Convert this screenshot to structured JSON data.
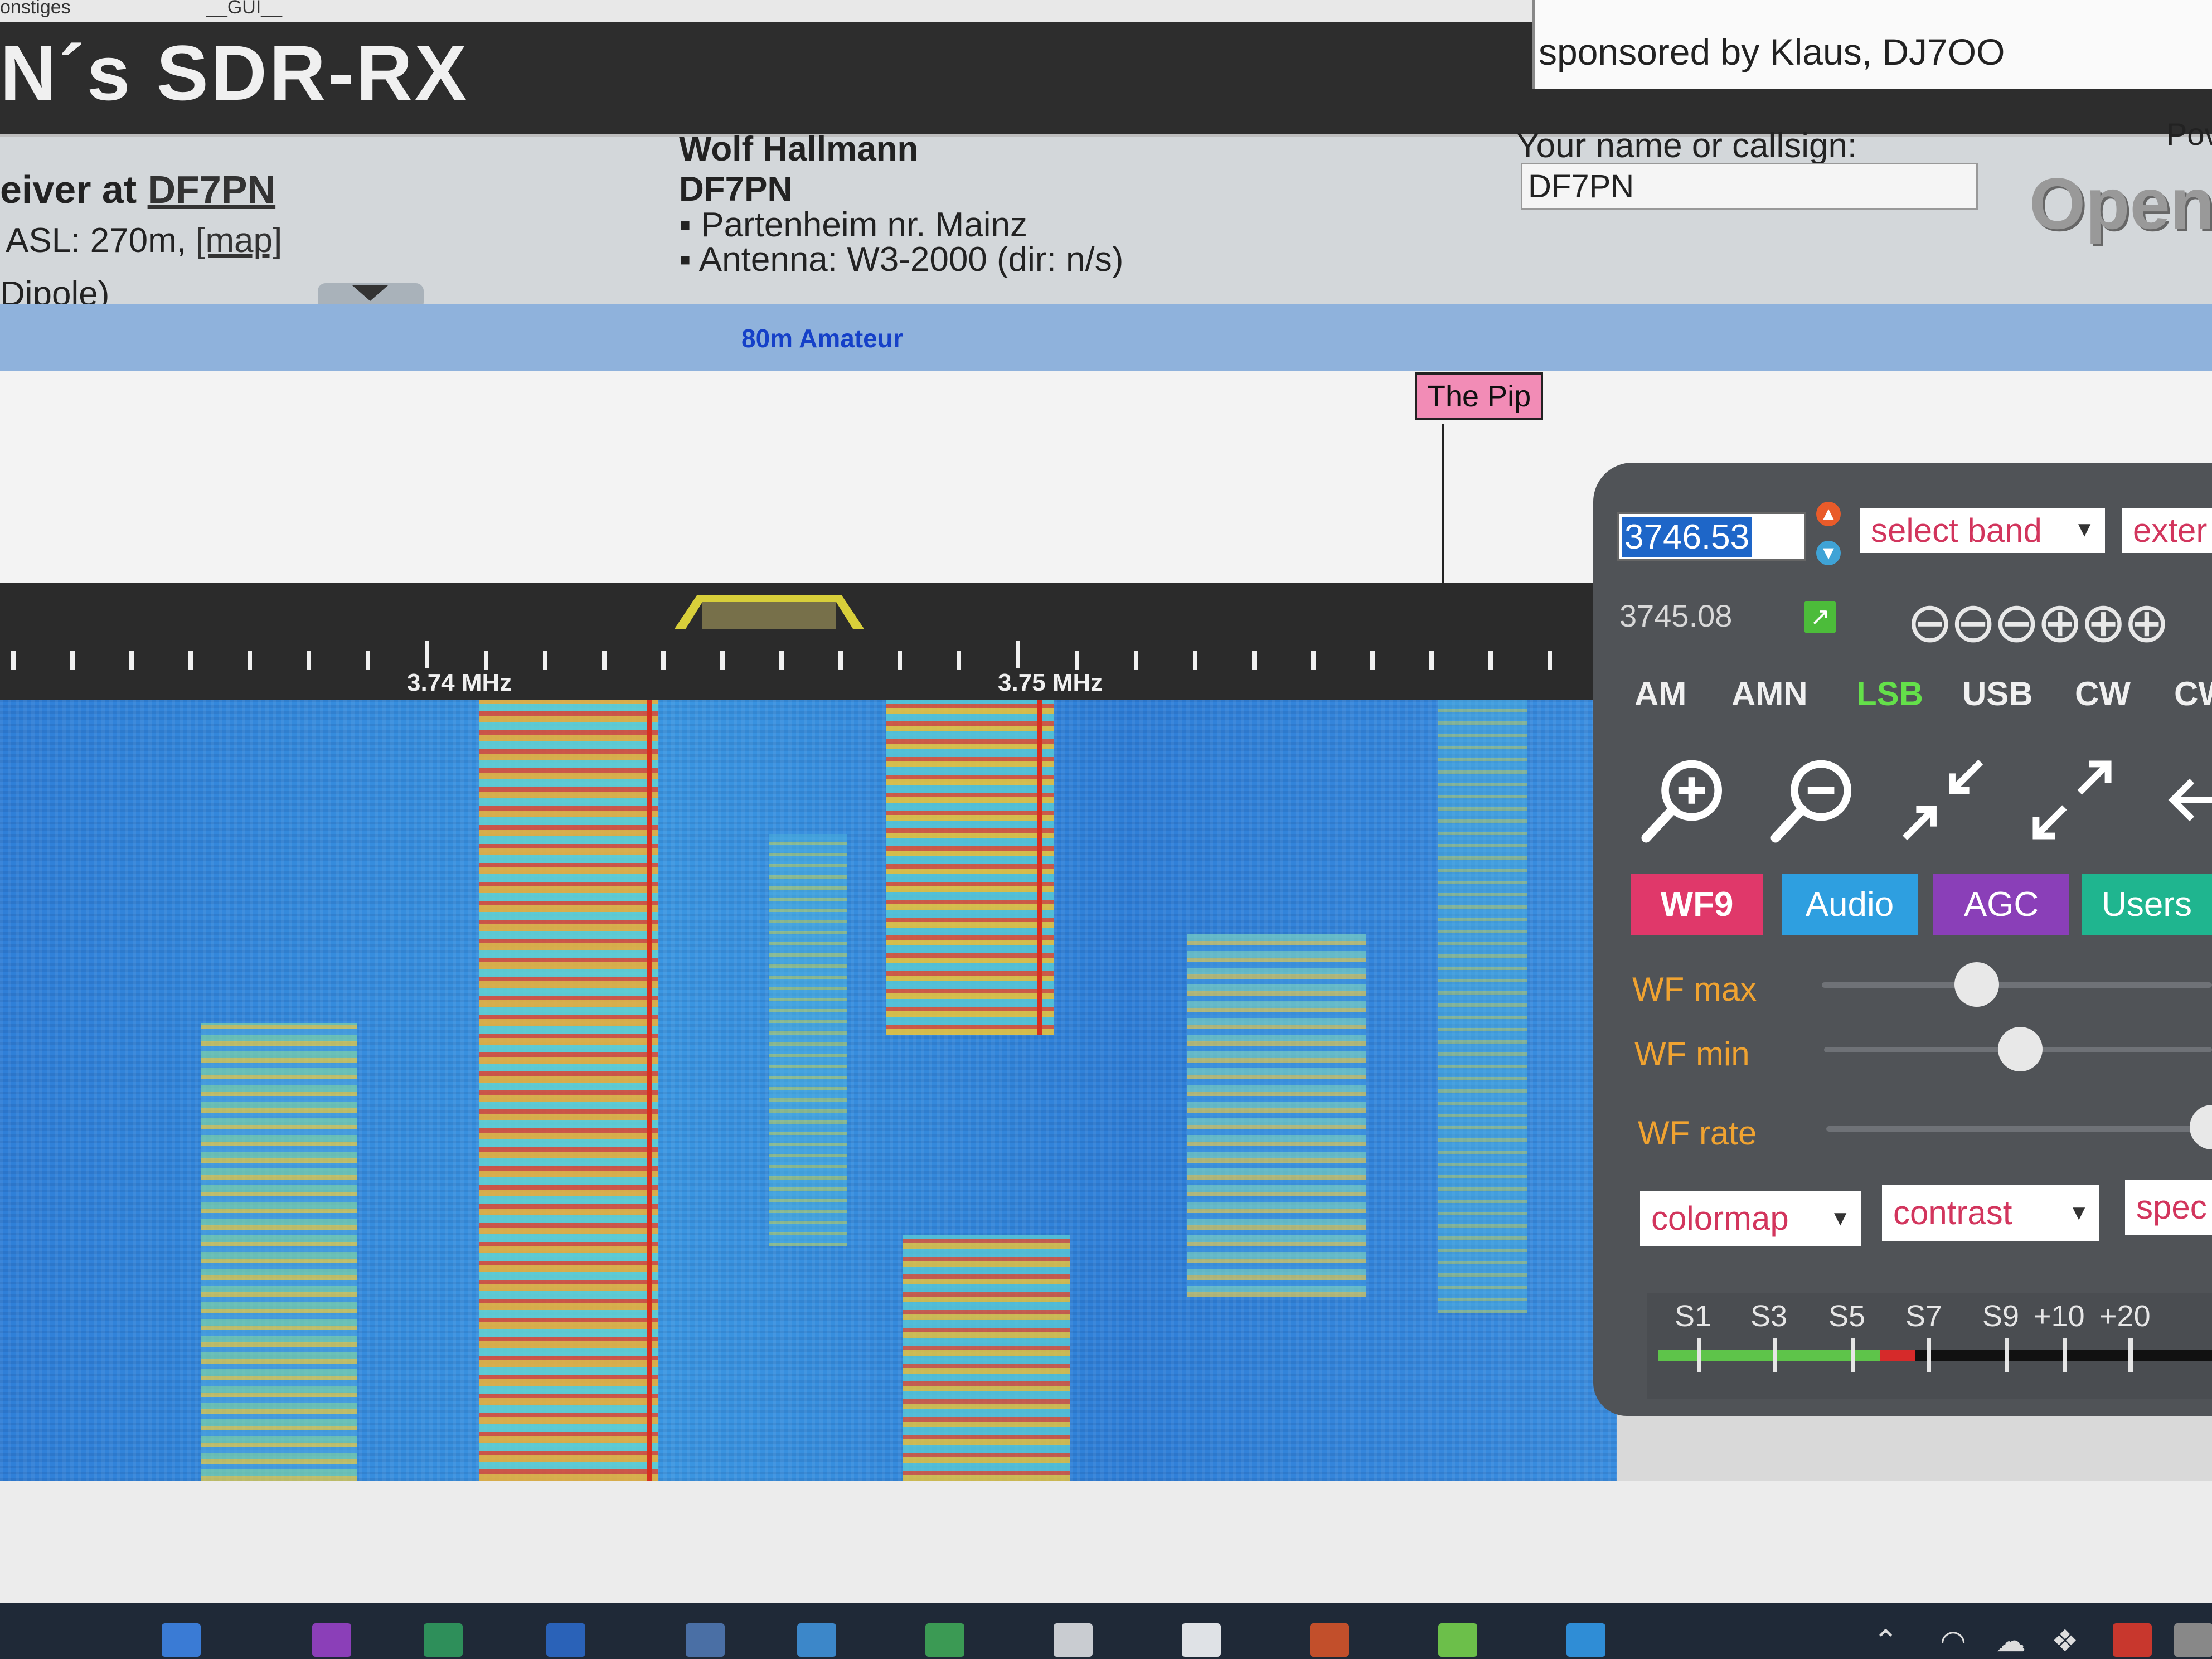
{
  "browser": {
    "bookmarks": [
      "onstiges",
      "__GUI__"
    ]
  },
  "header": {
    "title": "N´s SDR-RX",
    "sponsor": "sponsored by Klaus, DJ7OO"
  },
  "info": {
    "receiver_prefix": "eiver at ",
    "receiver_callsign": "DF7PN",
    "asl": "ASL: 270m, ",
    "map_link": "[map]",
    "antenna_short": "Dipole)",
    "owner_name": "Wolf Hallmann",
    "owner_call": "DF7PN",
    "location": "Partenheim nr. Mainz",
    "antenna": "Antenna: W3-2000 (dir: n/s)",
    "callsign_label": "Your name or callsign:",
    "callsign_value": "DF7PN",
    "powered_label": "Pov",
    "open_logo": "OpenW"
  },
  "band": {
    "label": "80m Amateur"
  },
  "marker": {
    "label": "The Pip"
  },
  "scale": {
    "labels": [
      "3.74 MHz",
      "3.75 MHz"
    ]
  },
  "controls": {
    "frequency": "3746.53",
    "last_frequency": "3745.08",
    "band_select": "select band",
    "ext_select": "exter",
    "zoom_steps": "⊖⊖⊖⊕⊕⊕",
    "modes": [
      "AM",
      "AMN",
      "LSB",
      "USB",
      "CW",
      "CW"
    ],
    "active_mode": "LSB",
    "tabs": [
      "WF9",
      "Audio",
      "AGC",
      "Users"
    ],
    "sliders": [
      {
        "label": "WF max",
        "value": 0.42
      },
      {
        "label": "WF min",
        "value": 0.5
      },
      {
        "label": "WF rate",
        "value": 1.0
      }
    ],
    "colormap_select": "colormap",
    "contrast_select": "contrast",
    "spec_select": "spec",
    "smeter_labels": [
      "S1",
      "S3",
      "S5",
      "S7",
      "S9",
      "+10",
      "+20"
    ],
    "smeter_level": 0.4
  },
  "colors": {
    "mode_active": "#64e04a",
    "tab_wf": "#e0386a",
    "tab_audio": "#2e9fe0",
    "tab_agc": "#8a3fb8",
    "tab_users": "#1fb58f",
    "slider_label": "#f0a331"
  }
}
